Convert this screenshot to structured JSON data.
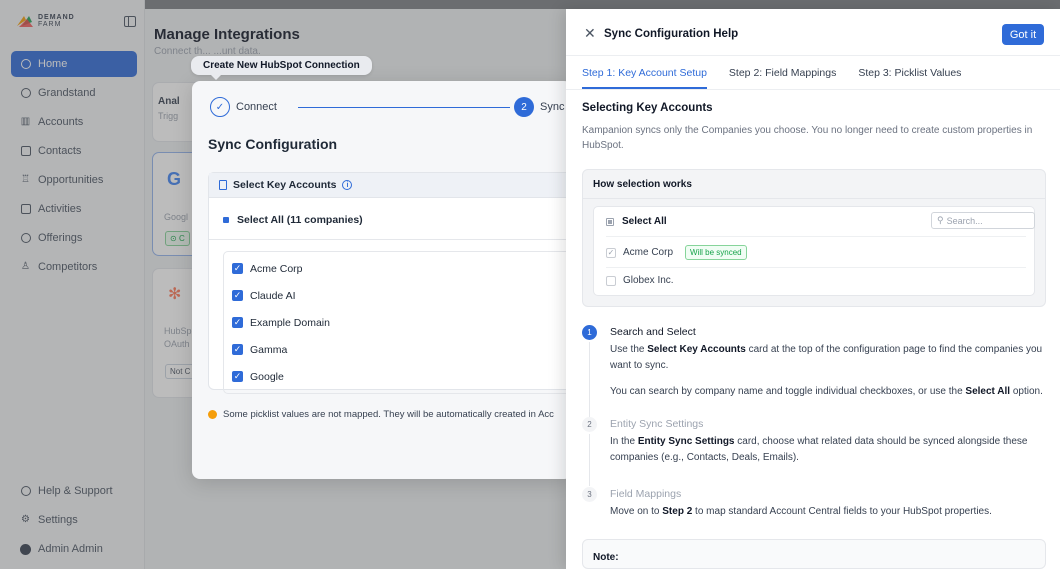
{
  "sidebar": {
    "logo_line1": "DEMAND",
    "logo_line2": "FARM",
    "items": [
      {
        "label": "Home",
        "icon": "home-icon"
      },
      {
        "label": "Grandstand",
        "icon": "clock-icon"
      },
      {
        "label": "Accounts",
        "icon": "building-icon"
      },
      {
        "label": "Contacts",
        "icon": "contact-card-icon"
      },
      {
        "label": "Opportunities",
        "icon": "trophy-icon"
      },
      {
        "label": "Activities",
        "icon": "calendar-icon"
      },
      {
        "label": "Offerings",
        "icon": "gift-icon"
      },
      {
        "label": "Competitors",
        "icon": "users-icon"
      }
    ],
    "help": "Help & Support",
    "settings": "Settings",
    "user": "Admin Admin"
  },
  "main": {
    "title": "Manage Integrations",
    "subtitle": "Connect th... ...unt data.",
    "card1_title": "Anal",
    "card1_sub": "Trigg",
    "card2_sub": "Googl",
    "card2_badge": "C",
    "card3_sub1": "HubSp",
    "card3_sub2": "OAuth",
    "card3_badge": "Not C"
  },
  "tooltip": "Create New HubSpot Connection",
  "wizard": {
    "step1_label": "Connect",
    "step2_num": "2",
    "step2_label": "Sync",
    "title": "Sync Configuration",
    "card_header": "Select Key Accounts",
    "select_all": "Select All (11 companies)",
    "companies": [
      "Acme Corp",
      "Claude AI",
      "Example Domain",
      "Gamma",
      "Google"
    ],
    "warning": "Some picklist values are not mapped. They will be automatically created in Acc"
  },
  "panel": {
    "title": "Sync Configuration Help",
    "got_it": "Got it",
    "tabs": [
      "Step 1: Key Account Setup",
      "Step 2: Field Mappings",
      "Step 3: Picklist Values"
    ],
    "section_title": "Selecting Key Accounts",
    "section_desc": "Kampanion syncs only the Companies you choose. You no longer need to create custom properties in HubSpot.",
    "how_title": "How selection works",
    "demo": {
      "select_all": "Select All",
      "search_placeholder": "Search...",
      "row1": "Acme Corp",
      "row1_badge": "Will be synced",
      "row2": "Globex Inc."
    },
    "steps": [
      {
        "num": "1",
        "title": "Search and Select"
      },
      {
        "num": "2",
        "title": "Entity Sync Settings"
      },
      {
        "num": "3",
        "title": "Field Mappings"
      }
    ],
    "step1_p1_a": "Use the ",
    "step1_p1_b": "Select Key Accounts",
    "step1_p1_c": " card at the top of the configuration page to find the companies you want to sync.",
    "step1_p2_a": "You can search by company name and toggle individual checkboxes, or use the ",
    "step1_p2_b": "Select All",
    "step1_p2_c": " option.",
    "step2_a": "In the ",
    "step2_b": "Entity Sync Settings",
    "step2_c": " card, choose what related data should be synced alongside these companies (e.g., Contacts, Deals, Emails).",
    "step3_a": "Move on to ",
    "step3_b": "Step 2",
    "step3_c": " to map standard Account Central fields to your HubSpot properties.",
    "note_label": "Note:"
  },
  "colors": {
    "accent": "#2f6bd8",
    "success": "#16a34a",
    "warning": "#f59e0b"
  }
}
